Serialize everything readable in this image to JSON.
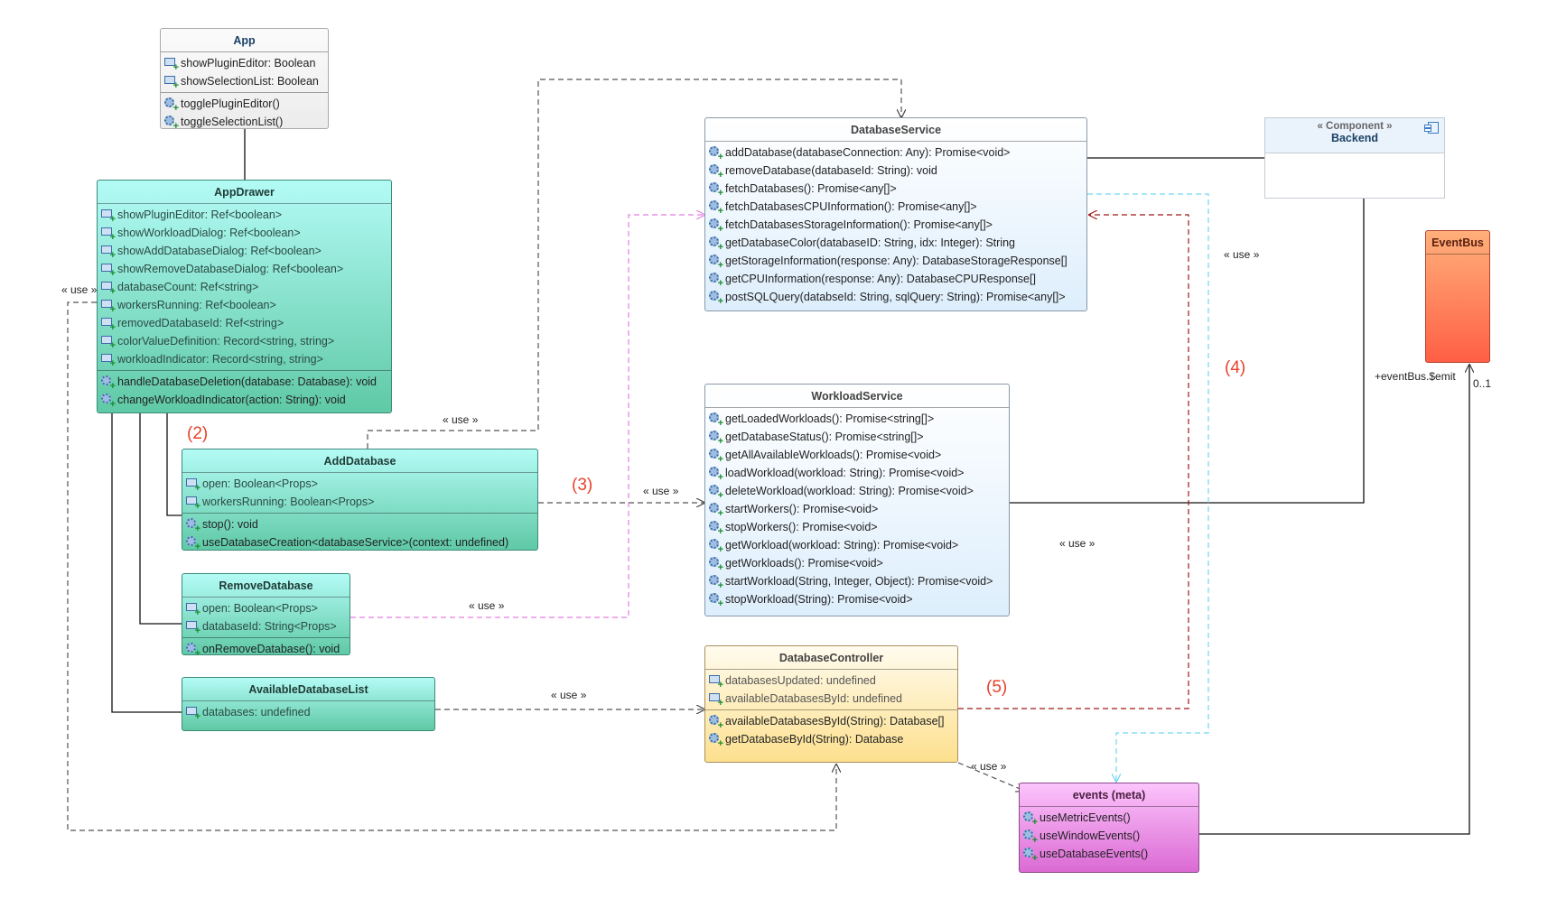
{
  "classes": {
    "app": {
      "name": "App",
      "attributes": [
        "showPluginEditor: Boolean",
        "showSelectionList: Boolean"
      ],
      "operations": [
        "togglePluginEditor()",
        "toggleSelectionList()"
      ]
    },
    "appdrawer": {
      "name": "AppDrawer",
      "attributes": [
        "showPluginEditor: Ref<boolean>",
        "showWorkloadDialog: Ref<boolean>",
        "showAddDatabaseDialog: Ref<boolean>",
        "showRemoveDatabaseDialog: Ref<boolean>",
        "databaseCount: Ref<string>",
        "workersRunning: Ref<boolean>",
        "removedDatabaseId: Ref<string>",
        "colorValueDefinition: Record<string, string>",
        "workloadIndicator: Record<string, string>"
      ],
      "operations": [
        "handleDatabaseDeletion(database: Database): void",
        "changeWorkloadIndicator(action: String): void"
      ]
    },
    "adddatabase": {
      "name": "AddDatabase",
      "attributes": [
        "open: Boolean<Props>",
        "workersRunning: Boolean<Props>"
      ],
      "operations": [
        "stop(): void",
        "useDatabaseCreation<databaseService>(context: undefined)"
      ]
    },
    "removedatabase": {
      "name": "RemoveDatabase",
      "attributes": [
        "open: Boolean<Props>",
        "databaseId: String<Props>"
      ],
      "operations": [
        "onRemoveDatabase(): void"
      ]
    },
    "availabledatabaselist": {
      "name": "AvailableDatabaseList",
      "attributes": [
        "databases: undefined"
      ],
      "operations": []
    },
    "databaseservice": {
      "name": "DatabaseService",
      "attributes": [],
      "operations": [
        "addDatabase(databaseConnection: Any): Promise<void>",
        "removeDatabase(databaseId: String): void",
        "fetchDatabases(): Promise<any[]>",
        "fetchDatabasesCPUInformation(): Promise<any[]>",
        "fetchDatabasesStorageInformation(): Promise<any[]>",
        "getDatabaseColor(databaseID: String, idx: Integer): String",
        "getStorageInformation(response: Any): DatabaseStorageResponse[]",
        "getCPUInformation(response: Any): DatabaseCPUResponse[]",
        "postSQLQuery(databseId: String, sqlQuery: String): Promise<any[]>"
      ]
    },
    "workloadservice": {
      "name": "WorkloadService",
      "attributes": [],
      "operations": [
        "getLoadedWorkloads(): Promise<string[]>",
        "getDatabaseStatus(): Promise<string[]>",
        "getAllAvailableWorkloads(): Promise<void>",
        "loadWorkload(workload: String): Promise<void>",
        "deleteWorkload(workload: String): Promise<void>",
        "startWorkers(): Promise<void>",
        "stopWorkers(): Promise<void>",
        "getWorkload(workload: String): Promise<void>",
        "getWorkloads(): Promise<void>",
        "startWorkload(String, Integer, Object): Promise<void>",
        "stopWorkload(String): Promise<void>"
      ]
    },
    "databasecontroller": {
      "name": "DatabaseController",
      "attributes": [
        "databasesUpdated: undefined",
        "availableDatabasesById: undefined"
      ],
      "operations": [
        "availableDatabasesById(String): Database[]",
        "getDatabaseById(String): Database"
      ]
    },
    "events": {
      "name": "events (meta)",
      "attributes": [],
      "operations": [
        "useMetricEvents()",
        "useWindowEvents()",
        "useDatabaseEvents()"
      ]
    },
    "eventbus": {
      "name": "EventBus",
      "attributes": [],
      "operations": []
    }
  },
  "component": {
    "stereotype": "« Component »",
    "name": "Backend"
  },
  "labels": {
    "use": "« use »",
    "emit": "+eventBus.$emit",
    "multiplicity": "0..1",
    "n2": "(2)",
    "n3": "(3)",
    "n4": "(4)",
    "n5": "(5)"
  },
  "colors": {
    "annotation": "#e8422b",
    "pink_dep": "#e47ee0",
    "red_dep": "#a01818",
    "cyan_dep": "#6fd6f2",
    "dep": "#555555"
  }
}
